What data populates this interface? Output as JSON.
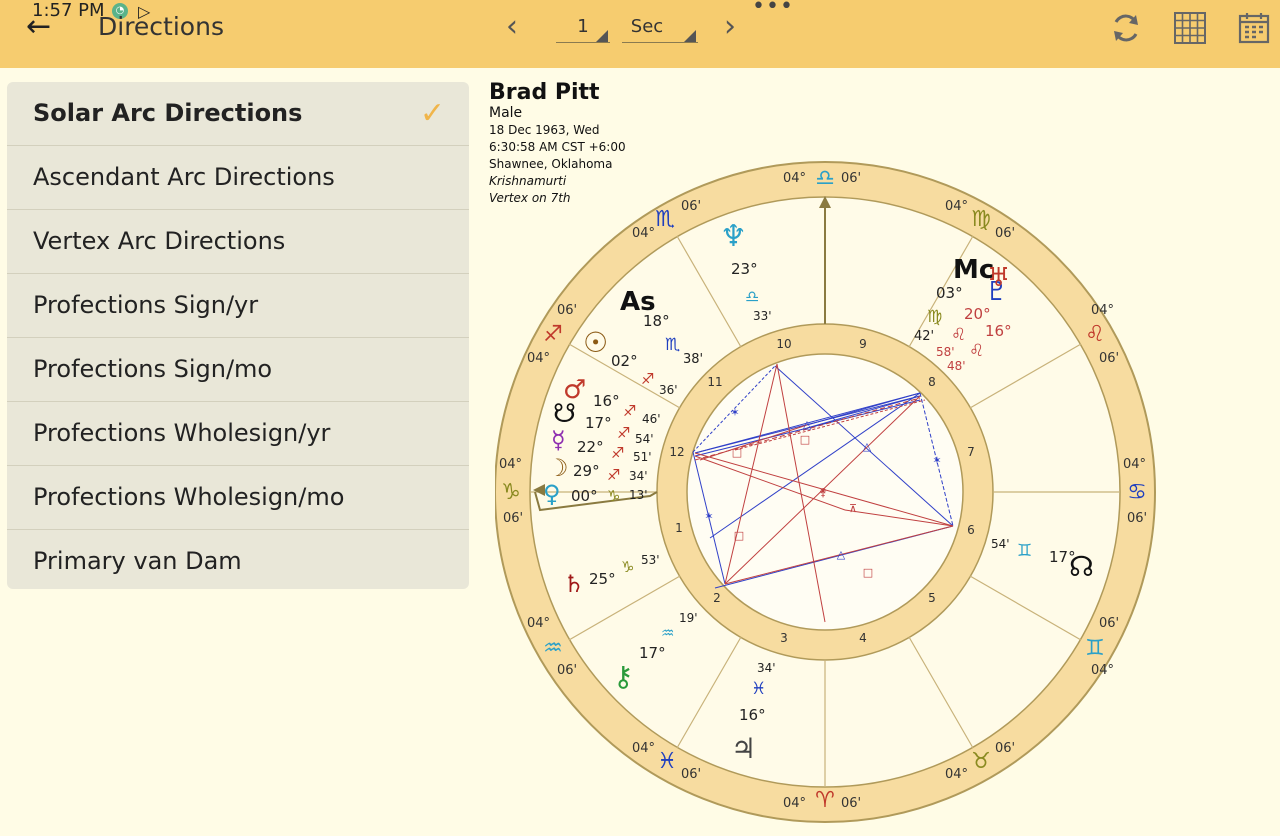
{
  "status_bar": {
    "time": "1:57 PM"
  },
  "toolbar": {
    "title": "Directions",
    "step_value": "1",
    "step_unit": "Sec"
  },
  "menu": {
    "items": [
      {
        "label": "Solar Arc Directions",
        "selected": true
      },
      {
        "label": "Ascendant Arc Directions",
        "selected": false
      },
      {
        "label": "Vertex Arc Directions",
        "selected": false
      },
      {
        "label": "Profections Sign/yr",
        "selected": false
      },
      {
        "label": "Profections Sign/mo",
        "selected": false
      },
      {
        "label": "Profections Wholesign/yr",
        "selected": false
      },
      {
        "label": "Profections Wholesign/mo",
        "selected": false
      },
      {
        "label": "Primary van Dam",
        "selected": false
      }
    ]
  },
  "person": {
    "name": "Brad Pitt",
    "gender": "Male",
    "date": "18 Dec 1963, Wed",
    "time": "6:30:58 AM CST +6:00",
    "place": "Shawnee, Oklahoma",
    "system": "Krishnamurti",
    "vertex": "Vertex on 7th"
  },
  "chart": {
    "cusps": [
      {
        "label": "As",
        "deg": "18°",
        "min": "38'",
        "sign": "♏"
      },
      {
        "label": "Mc",
        "deg": "03°",
        "min": "42'",
        "sign": "♍"
      }
    ],
    "zodiac_ring": {
      "deg_label": "04°",
      "min_label": "06'",
      "signs": [
        "♈",
        "♉",
        "♊",
        "♋",
        "♌",
        "♍",
        "♎",
        "♏",
        "♐",
        "♑",
        "♒",
        "♓"
      ]
    },
    "planets": [
      {
        "name": "neptune",
        "glyph": "♆",
        "deg": "23°",
        "sign": "♎",
        "min": "33'"
      },
      {
        "name": "pluto",
        "glyph": "♇",
        "deg": "16°",
        "sign": "♌",
        "min": "48'"
      },
      {
        "name": "uranus",
        "glyph": "♅",
        "deg": "20°",
        "sign": "♌",
        "min": "58'"
      },
      {
        "name": "sun",
        "glyph": "☉",
        "deg": "02°",
        "sign": "♐",
        "min": "36'"
      },
      {
        "name": "mars",
        "glyph": "♂",
        "deg": "16°",
        "sign": "♐",
        "min": "46'"
      },
      {
        "name": "south-node",
        "glyph": "☋",
        "deg": "17°",
        "sign": "♐",
        "min": "54'"
      },
      {
        "name": "mercury",
        "glyph": "☿",
        "deg": "22°",
        "sign": "♐",
        "min": "51'"
      },
      {
        "name": "moon",
        "glyph": "☽",
        "deg": "29°",
        "sign": "♐",
        "min": "34'"
      },
      {
        "name": "venus",
        "glyph": "♀",
        "deg": "00°",
        "sign": "♑",
        "min": "13'"
      },
      {
        "name": "saturn",
        "glyph": "♄",
        "deg": "25°",
        "sign": "♑",
        "min": "53'"
      },
      {
        "name": "chiron",
        "glyph": "⚷",
        "deg": "17°",
        "sign": "♒",
        "min": "19'"
      },
      {
        "name": "jupiter",
        "glyph": "♃",
        "deg": "16°",
        "sign": "♓",
        "min": "34'"
      },
      {
        "name": "north-node",
        "glyph": "☊",
        "deg": "17°",
        "sign": "♊",
        "min": "54'"
      }
    ],
    "houses": [
      "1",
      "2",
      "3",
      "4",
      "5",
      "6",
      "7",
      "8",
      "9",
      "10",
      "11",
      "12"
    ]
  }
}
